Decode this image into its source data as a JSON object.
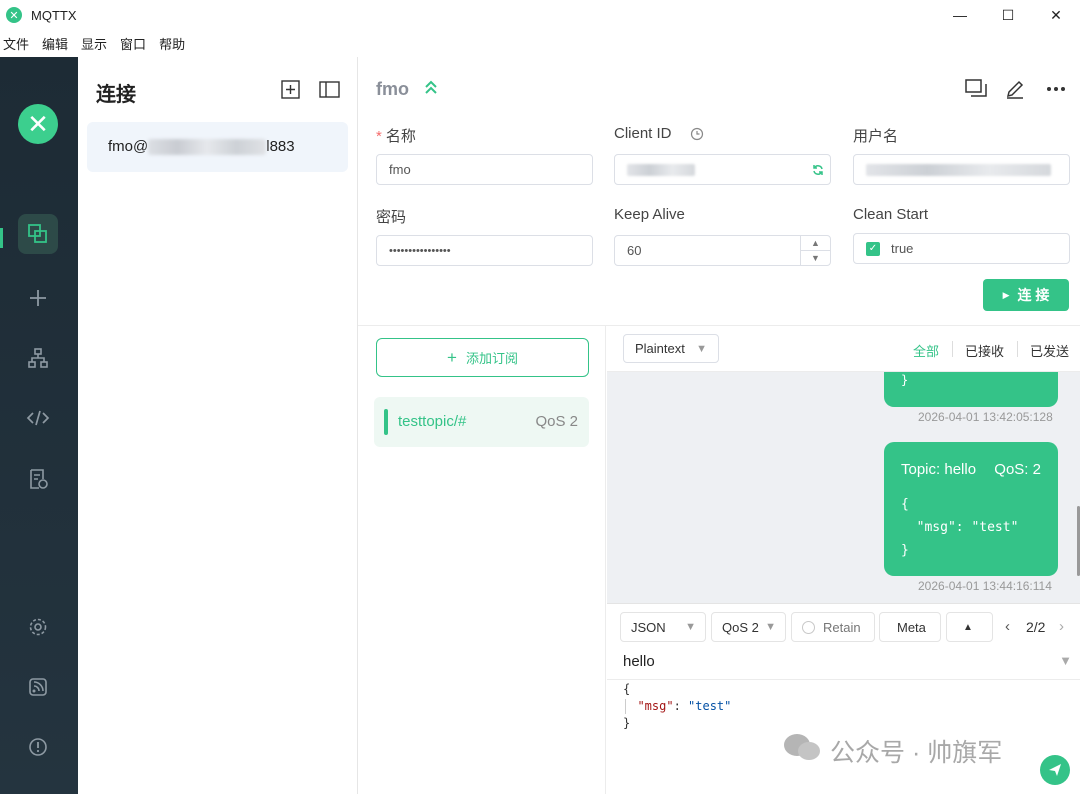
{
  "window": {
    "title": "MQTTX",
    "minimize": "—",
    "maximize": "☐",
    "close": "✕"
  },
  "menu": [
    "文件",
    "编辑",
    "显示",
    "窗口",
    "帮助"
  ],
  "sidebar": {
    "logo": "✕",
    "icons": [
      "connections-icon",
      "add-icon",
      "topology-icon",
      "script-icon",
      "log-icon",
      "settings-icon",
      "feed-icon",
      "about-icon"
    ]
  },
  "connections": {
    "title": "连接",
    "items": [
      {
        "prefix": "fmo@",
        "suffix": "l883"
      }
    ]
  },
  "header": {
    "name": "fmo"
  },
  "form": {
    "name_label": "名称",
    "name_value": "fmo",
    "client_id_label": "Client ID",
    "username_label": "用户名",
    "password_label": "密码",
    "password_value": "••••••••••••••••",
    "keepalive_label": "Keep Alive",
    "keepalive_value": "60",
    "clean_start_label": "Clean Start",
    "clean_start_value": "true",
    "connect_label": "连 接"
  },
  "subscriptions": {
    "add_label": "添加订阅",
    "items": [
      {
        "topic": "testtopic/#",
        "qos": "QoS 2"
      }
    ]
  },
  "messages": {
    "format": "Plaintext",
    "filters": [
      "全部",
      "已接收",
      "已发送"
    ],
    "items": [
      {
        "time": "2026-04-01 13:42:05:128",
        "tail": "}"
      },
      {
        "topic": "Topic: hello",
        "qos": "QoS: 2",
        "body": "{\n  \"msg\": \"test\"\n}",
        "time": "2026-04-01 13:44:16:114"
      }
    ]
  },
  "publish": {
    "format": "JSON",
    "qos": "QoS 2",
    "retain": "Retain",
    "meta": "Meta",
    "page": "2/2",
    "topic": "hello",
    "body_open": "{",
    "body_key": "\"msg\"",
    "body_colon": ": ",
    "body_value": "\"test\"",
    "body_close": "}"
  },
  "watermark": "公众号 · 帅旗军",
  "colors": {
    "accent": "#34c388",
    "sidebar": "#1d2b35"
  }
}
